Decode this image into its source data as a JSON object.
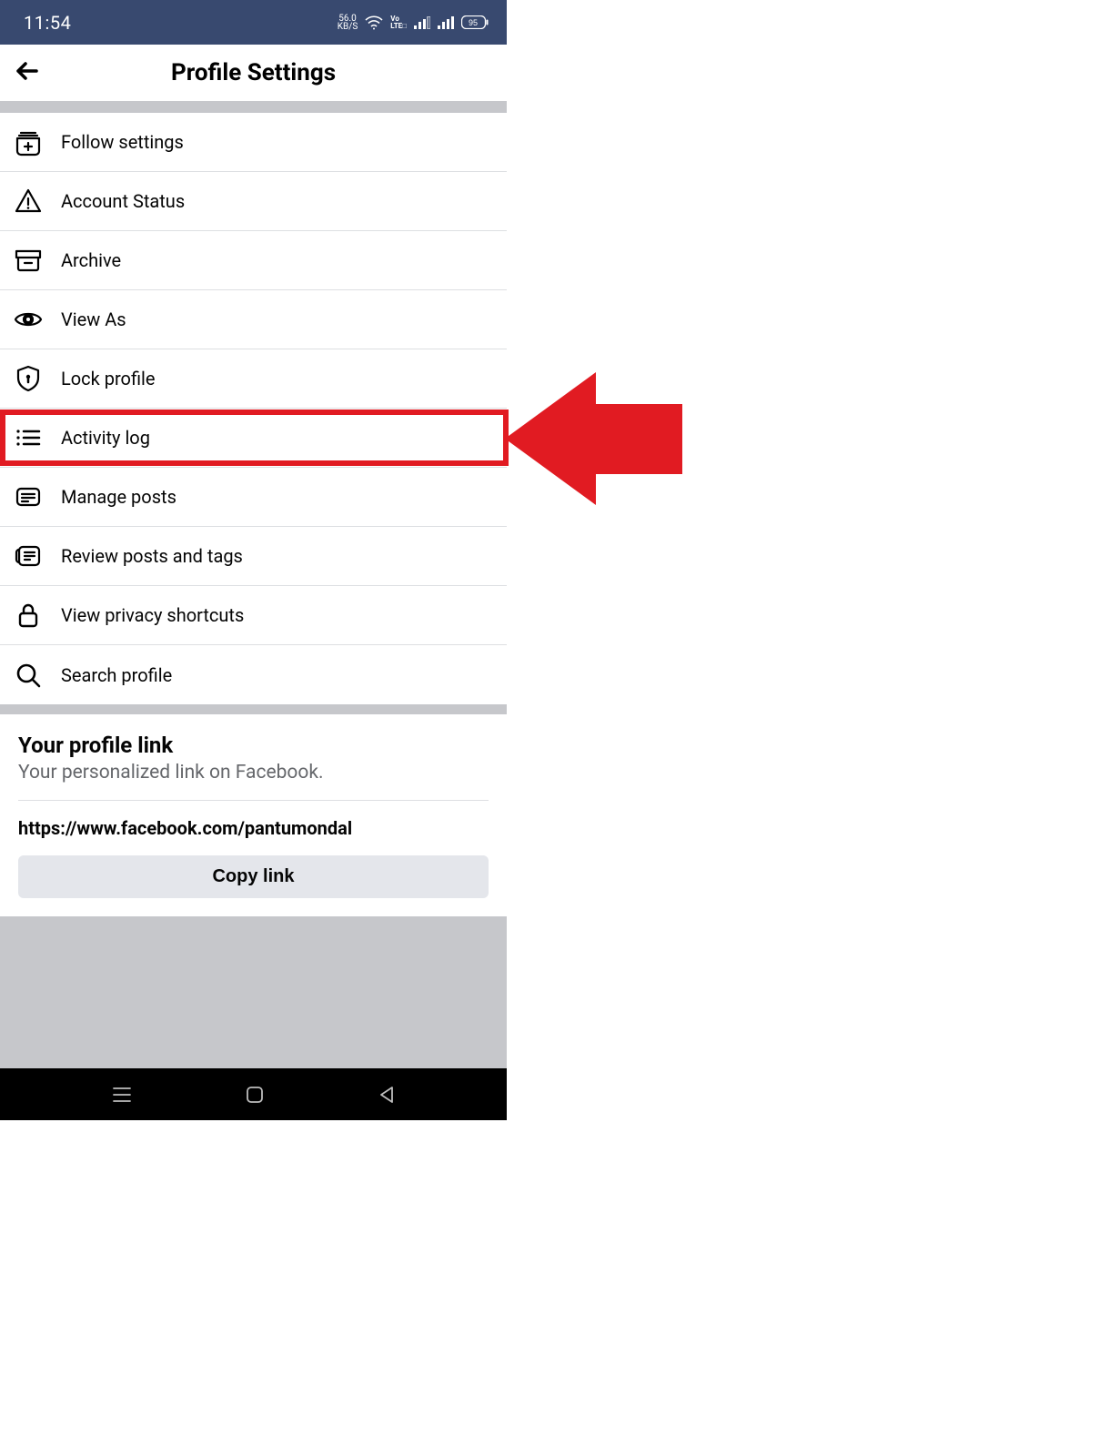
{
  "status": {
    "time": "11:54",
    "kbs_top": "56.0",
    "kbs_bottom": "KB/S",
    "battery": "95"
  },
  "header": {
    "title": "Profile Settings"
  },
  "menu": {
    "items": [
      {
        "label": "Follow settings"
      },
      {
        "label": "Account Status"
      },
      {
        "label": "Archive"
      },
      {
        "label": "View As"
      },
      {
        "label": "Lock profile"
      },
      {
        "label": "Activity log"
      },
      {
        "label": "Manage posts"
      },
      {
        "label": "Review posts and tags"
      },
      {
        "label": "View privacy shortcuts"
      },
      {
        "label": "Search profile"
      }
    ]
  },
  "profile_link": {
    "title": "Your profile link",
    "subtitle": "Your personalized link on Facebook.",
    "url": "https://www.facebook.com/pantumondal",
    "copy_label": "Copy link"
  }
}
